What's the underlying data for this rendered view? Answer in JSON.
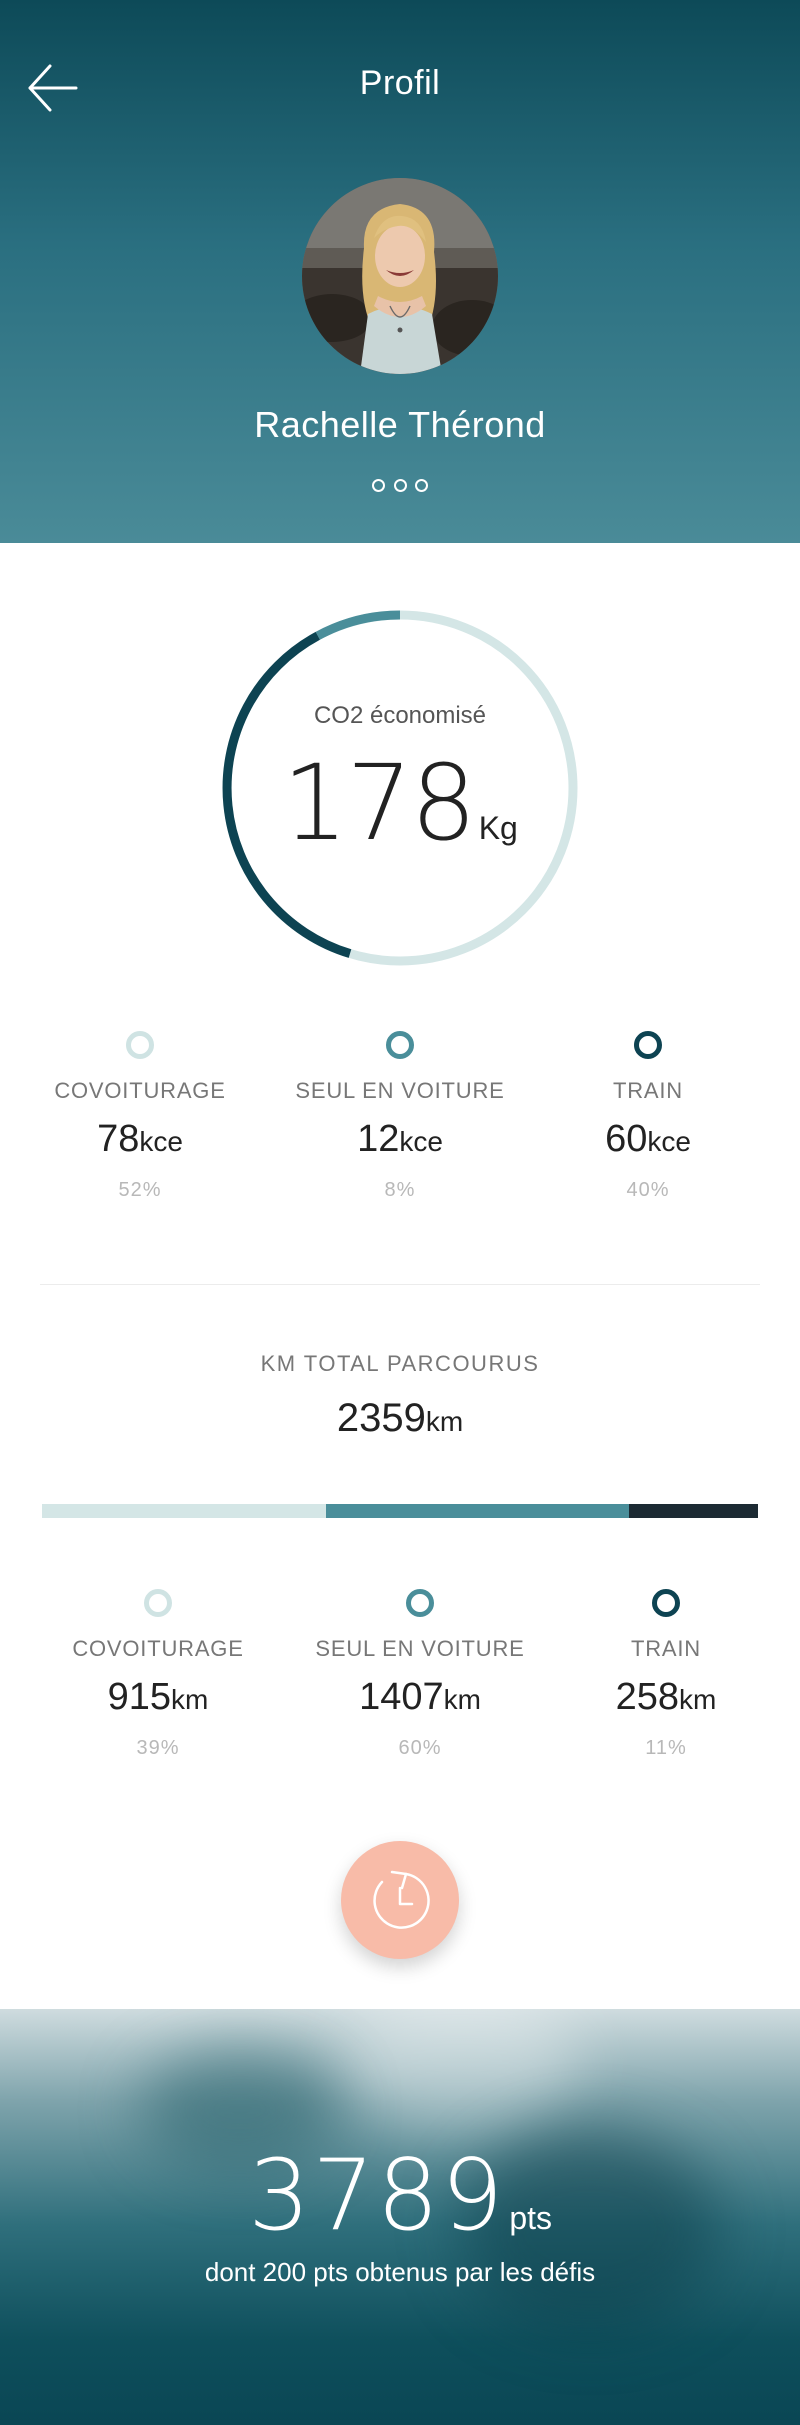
{
  "header": {
    "title": "Profil",
    "name": "Rachelle Thérond"
  },
  "gauge": {
    "label": "CO2 économisé",
    "value": "178",
    "unit": "Kg"
  },
  "co2_stats": [
    {
      "label": "COVOITURAGE",
      "value": "78",
      "unit": "kce",
      "pct": "52%",
      "color": "#cfe3e3"
    },
    {
      "label": "SEUL EN VOITURE",
      "value": "12",
      "unit": "kce",
      "pct": "8%",
      "color": "#4a8e9a"
    },
    {
      "label": "TRAIN",
      "value": "60",
      "unit": "kce",
      "pct": "40%",
      "color": "#0d4352"
    }
  ],
  "km": {
    "title": "KM TOTAL PARCOURUS",
    "total": "2359",
    "unit": "km",
    "stats": [
      {
        "label": "COVOITURAGE",
        "value": "915",
        "unit": "km",
        "pct": "39%",
        "color": "#cfe3e3"
      },
      {
        "label": "SEUL EN VOITURE",
        "value": "1407",
        "unit": "km",
        "pct": "60%",
        "color": "#4a8e9a"
      },
      {
        "label": "TRAIN",
        "value": "258",
        "unit": "km",
        "pct": "11%",
        "color": "#0d4352"
      }
    ],
    "bar_fractions": [
      0.396,
      0.424,
      0.18
    ],
    "bar_colors": [
      "#d4e6e6",
      "#4a8e9a",
      "#1c2a33"
    ]
  },
  "points": {
    "value": "3789",
    "unit": "pts",
    "subtitle": "dont 200 pts obtenus par les défis"
  },
  "colors": {
    "accent": "#4a8e9a",
    "dark": "#0d4352",
    "light": "#cfe3e3",
    "fab": "#f8bba8"
  }
}
